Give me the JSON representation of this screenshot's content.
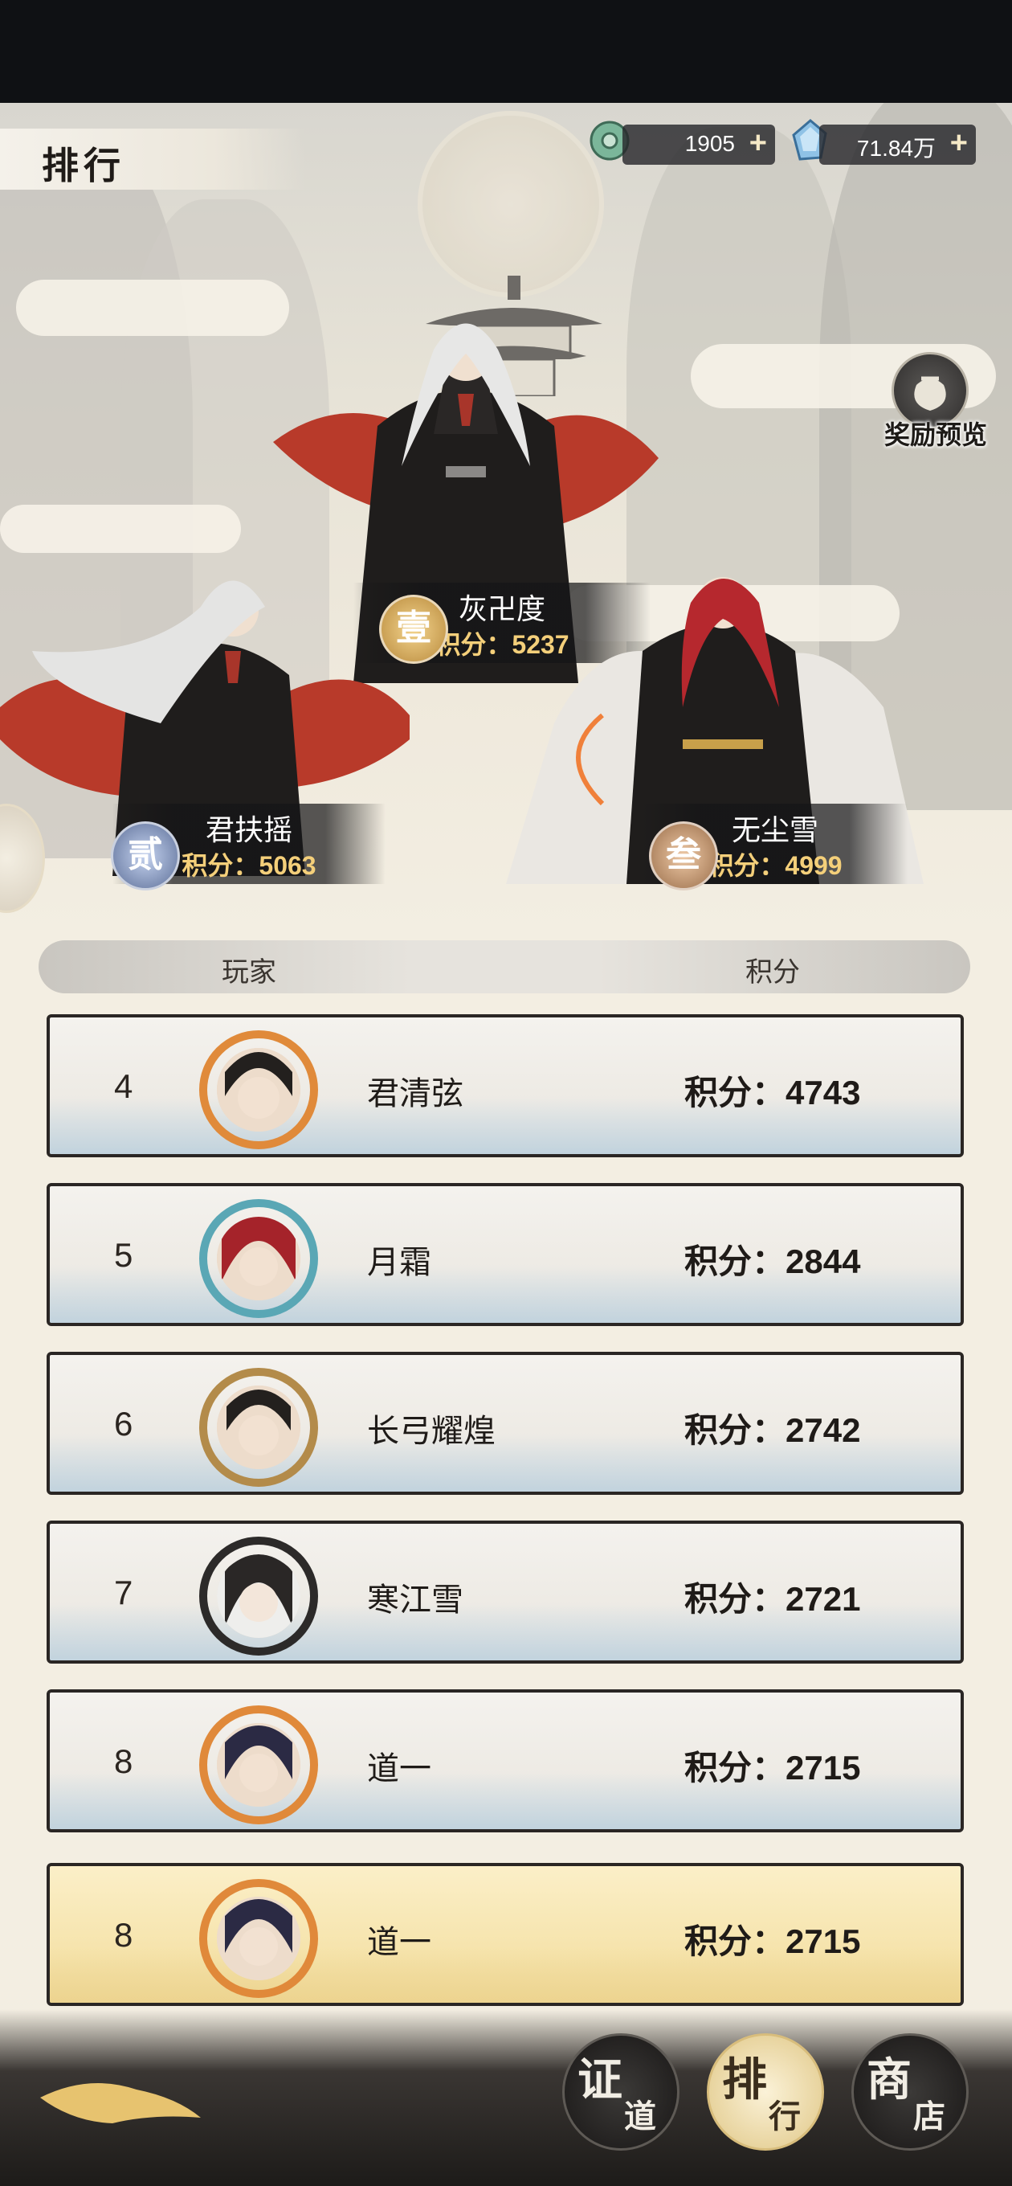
{
  "header": {
    "title": "排行",
    "resources": [
      {
        "icon": "jade-coin-icon",
        "value": "1905",
        "plus": "+"
      },
      {
        "icon": "crystal-gem-icon",
        "value": "71.84万",
        "plus": "+"
      }
    ],
    "reward_preview_label": "奖励预览"
  },
  "podium": [
    {
      "rank_glyph": "壹",
      "name": "灰卍度",
      "score": "积分：5237",
      "badge_color": "#c79a55"
    },
    {
      "rank_glyph": "贰",
      "name": "君扶摇",
      "score": "积分：5063",
      "badge_color": "#7f92b8"
    },
    {
      "rank_glyph": "叁",
      "name": "无尘雪",
      "score": "积分：4999",
      "badge_color": "#b98a63"
    }
  ],
  "table": {
    "columns": [
      "玩家",
      "积分"
    ],
    "rows": [
      {
        "rank": "4",
        "name": "君清弦",
        "score": "积分：4743",
        "ring": "#e08a3a"
      },
      {
        "rank": "5",
        "name": "月霜",
        "score": "积分：2844",
        "ring": "#5aa7b5"
      },
      {
        "rank": "6",
        "name": "长弓耀煌",
        "score": "积分：2742",
        "ring": "#b38b4a"
      },
      {
        "rank": "7",
        "name": "寒江雪",
        "score": "积分：2721",
        "ring": "#2c2a29"
      },
      {
        "rank": "8",
        "name": "道一",
        "score": "积分：2715",
        "ring": "#e0893a"
      }
    ],
    "self_row": {
      "rank": "8",
      "name": "道一",
      "score": "积分：2715",
      "ring": "#e0893a"
    }
  },
  "bottom_nav": [
    {
      "big": "证",
      "small": "道",
      "active": false
    },
    {
      "big": "排",
      "small": "行",
      "active": true
    },
    {
      "big": "商",
      "small": "店",
      "active": false
    }
  ],
  "colors": {
    "accent_gold": "#f4cf7a",
    "self_row_bg": "#f6e4ad",
    "page_bg": "#f3eee2"
  }
}
